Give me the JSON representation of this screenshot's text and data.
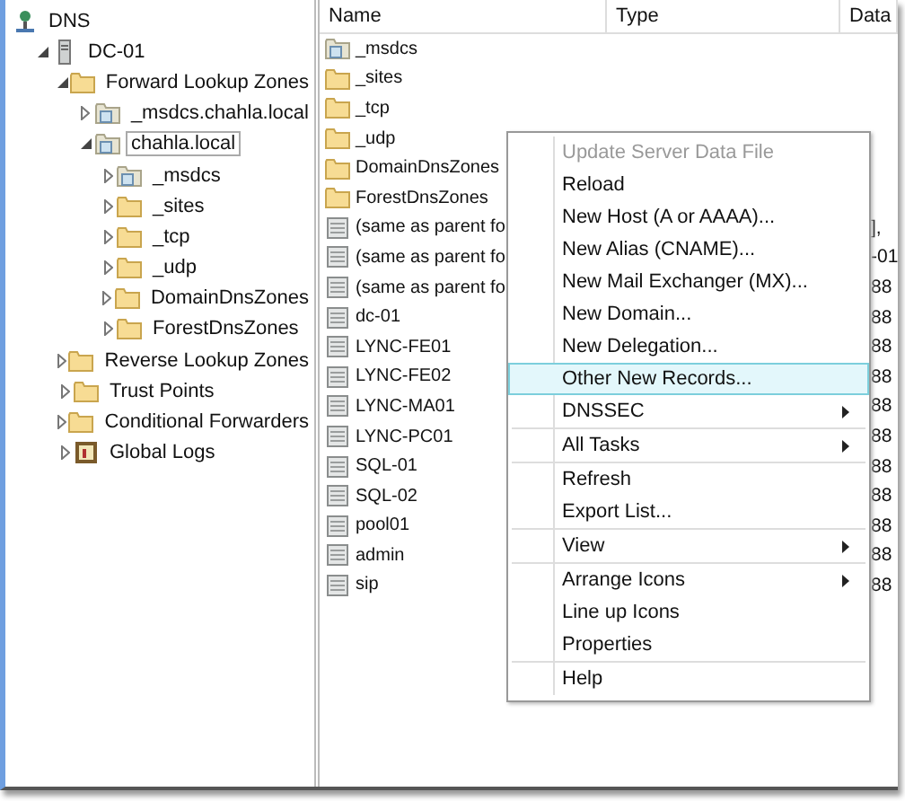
{
  "tree": [
    {
      "label": "DNS",
      "kind": "dns",
      "selected": false,
      "children": [
        {
          "label": "DC-01",
          "kind": "server",
          "expanded": true,
          "selected": false,
          "children": [
            {
              "label": "Forward Lookup Zones",
              "kind": "folder",
              "expanded": true,
              "selected": false,
              "children": [
                {
                  "label": "_msdcs.chahla.local",
                  "kind": "zone",
                  "expanded": false,
                  "selected": false
                },
                {
                  "label": "chahla.local",
                  "kind": "zone",
                  "expanded": true,
                  "selected": true,
                  "children": [
                    {
                      "label": "_msdcs",
                      "kind": "zone",
                      "expanded": false,
                      "selected": false
                    },
                    {
                      "label": "_sites",
                      "kind": "folder",
                      "expanded": false,
                      "selected": false
                    },
                    {
                      "label": "_tcp",
                      "kind": "folder",
                      "expanded": false,
                      "selected": false
                    },
                    {
                      "label": "_udp",
                      "kind": "folder",
                      "expanded": false,
                      "selected": false
                    },
                    {
                      "label": "DomainDnsZones",
                      "kind": "folder",
                      "expanded": false,
                      "selected": false
                    },
                    {
                      "label": "ForestDnsZones",
                      "kind": "folder",
                      "expanded": false,
                      "selected": false
                    }
                  ]
                }
              ]
            },
            {
              "label": "Reverse Lookup Zones",
              "kind": "folder",
              "expanded": false,
              "selected": false
            },
            {
              "label": "Trust Points",
              "kind": "folder",
              "expanded": false,
              "selected": false
            },
            {
              "label": "Conditional Forwarders",
              "kind": "folder",
              "expanded": false,
              "selected": false
            },
            {
              "label": "Global Logs",
              "kind": "logs",
              "expanded": false,
              "selected": false
            }
          ]
        }
      ]
    }
  ],
  "list": {
    "columns": [
      "Name",
      "Type",
      "Data"
    ],
    "rows": [
      {
        "name": "_msdcs",
        "kind": "zone"
      },
      {
        "name": "_sites",
        "kind": "folder"
      },
      {
        "name": "_tcp",
        "kind": "folder"
      },
      {
        "name": "_udp",
        "kind": "folder"
      },
      {
        "name": "DomainDnsZones",
        "kind": "folder"
      },
      {
        "name": "ForestDnsZones",
        "kind": "folder"
      },
      {
        "name": "(same as parent fo",
        "kind": "record",
        "data": "],"
      },
      {
        "name": "(same as parent fo",
        "kind": "record",
        "data": "-01"
      },
      {
        "name": "(same as parent fo",
        "kind": "record",
        "data": "88"
      },
      {
        "name": "dc-01",
        "kind": "record",
        "data": "88"
      },
      {
        "name": "LYNC-FE01",
        "kind": "record",
        "data": "88"
      },
      {
        "name": "LYNC-FE02",
        "kind": "record",
        "data": "88"
      },
      {
        "name": "LYNC-MA01",
        "kind": "record",
        "data": "88"
      },
      {
        "name": "LYNC-PC01",
        "kind": "record",
        "data": "88"
      },
      {
        "name": "SQL-01",
        "kind": "record",
        "data": "88"
      },
      {
        "name": "SQL-02",
        "kind": "record",
        "data": "88"
      },
      {
        "name": "pool01",
        "kind": "record",
        "data": "88"
      },
      {
        "name": "admin",
        "kind": "record",
        "data": "88"
      },
      {
        "name": "sip",
        "kind": "record",
        "data": "88"
      }
    ]
  },
  "context_menu": {
    "groups": [
      [
        {
          "label": "Update Server Data File",
          "disabled": true,
          "submenu": false,
          "selected": false
        },
        {
          "label": "Reload",
          "disabled": false,
          "submenu": false,
          "selected": false
        },
        {
          "label": "New Host (A or AAAA)...",
          "disabled": false,
          "submenu": false,
          "selected": false
        },
        {
          "label": "New Alias (CNAME)...",
          "disabled": false,
          "submenu": false,
          "selected": false
        },
        {
          "label": "New Mail Exchanger (MX)...",
          "disabled": false,
          "submenu": false,
          "selected": false
        },
        {
          "label": "New Domain...",
          "disabled": false,
          "submenu": false,
          "selected": false
        },
        {
          "label": "New Delegation...",
          "disabled": false,
          "submenu": false,
          "selected": false
        },
        {
          "label": "Other New Records...",
          "disabled": false,
          "submenu": false,
          "selected": true
        },
        {
          "label": "DNSSEC",
          "disabled": false,
          "submenu": true,
          "selected": false
        }
      ],
      [
        {
          "label": "All Tasks",
          "disabled": false,
          "submenu": true,
          "selected": false
        }
      ],
      [
        {
          "label": "Refresh",
          "disabled": false,
          "submenu": false,
          "selected": false
        },
        {
          "label": "Export List...",
          "disabled": false,
          "submenu": false,
          "selected": false
        }
      ],
      [
        {
          "label": "View",
          "disabled": false,
          "submenu": true,
          "selected": false
        }
      ],
      [
        {
          "label": "Arrange Icons",
          "disabled": false,
          "submenu": true,
          "selected": false
        },
        {
          "label": "Line up Icons",
          "disabled": false,
          "submenu": false,
          "selected": false
        },
        {
          "label": "Properties",
          "disabled": false,
          "submenu": false,
          "selected": false
        }
      ],
      [
        {
          "label": "Help",
          "disabled": false,
          "submenu": false,
          "selected": false
        }
      ]
    ]
  }
}
